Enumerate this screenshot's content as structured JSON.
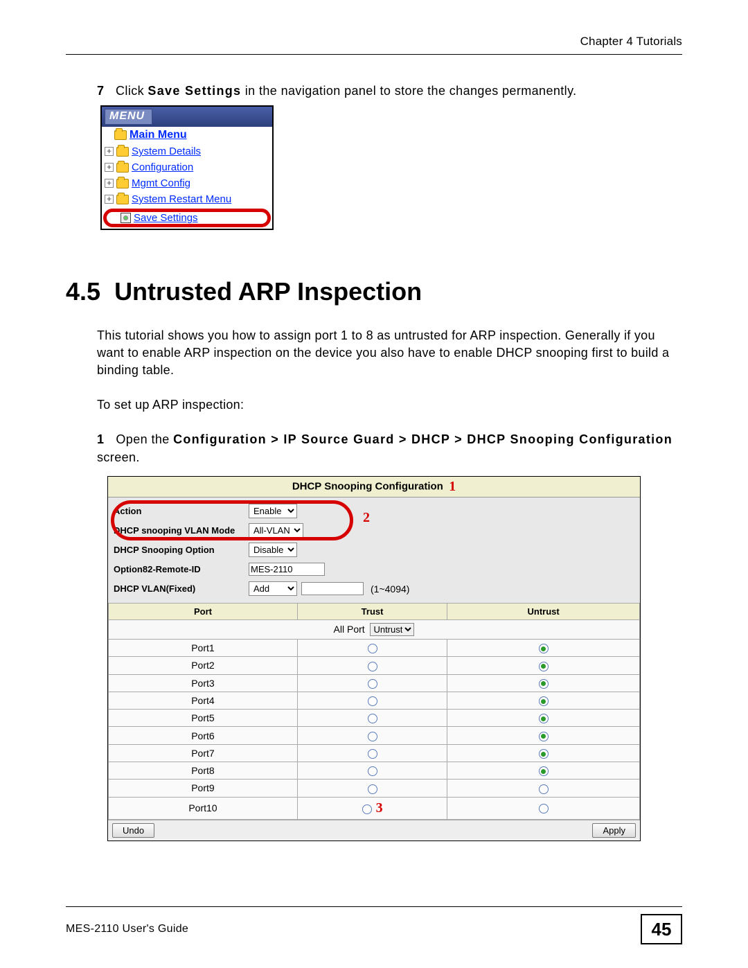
{
  "header": {
    "chapter": "Chapter 4 Tutorials"
  },
  "step7": {
    "num": "7",
    "pre": "Click ",
    "bold": "Save Settings",
    "post": " in the navigation panel to store the changes permanently."
  },
  "menu": {
    "title": "MENU",
    "main": "Main Menu",
    "items": [
      "System Details",
      "Configuration",
      "Mgmt Config",
      "System Restart Menu"
    ],
    "save": "Save Settings"
  },
  "section": {
    "num": "4.5",
    "title": "Untrusted ARP Inspection"
  },
  "intro": "This tutorial shows you how to assign port 1 to 8 as untrusted for ARP inspection. Generally if you want to enable ARP inspection on the device you also have to enable DHCP snooping first to build a binding table.",
  "setup_line": "To set up ARP inspection:",
  "step1": {
    "num": "1",
    "pre": "Open the ",
    "path": "Configuration > IP Source Guard > DHCP > DHCP Snooping Configuration",
    "post": " screen."
  },
  "dhcp": {
    "title": "DHCP Snooping Configuration",
    "anno1": "1",
    "anno2": "2",
    "anno3": "3",
    "rows": {
      "action": {
        "label": "Action",
        "value": "Enable"
      },
      "vlan_mode": {
        "label": "DHCP snooping VLAN Mode",
        "value": "All-VLAN"
      },
      "option": {
        "label": "DHCP Snooping Option",
        "value": "Disable"
      },
      "remote_id": {
        "label": "Option82-Remote-ID",
        "value": "MES-2110"
      },
      "vlan_fixed": {
        "label": "DHCP VLAN(Fixed)",
        "value": "Add",
        "hint": "(1~4094)"
      }
    },
    "headers": {
      "port": "Port",
      "trust": "Trust",
      "untrust": "Untrust"
    },
    "allport": {
      "label": "All Port",
      "value": "Untrust"
    },
    "ports": [
      {
        "name": "Port1",
        "trust": false,
        "untrust": true
      },
      {
        "name": "Port2",
        "trust": false,
        "untrust": true
      },
      {
        "name": "Port3",
        "trust": false,
        "untrust": true
      },
      {
        "name": "Port4",
        "trust": false,
        "untrust": true
      },
      {
        "name": "Port5",
        "trust": false,
        "untrust": true
      },
      {
        "name": "Port6",
        "trust": false,
        "untrust": true
      },
      {
        "name": "Port7",
        "trust": false,
        "untrust": true
      },
      {
        "name": "Port8",
        "trust": false,
        "untrust": true
      },
      {
        "name": "Port9",
        "trust": false,
        "untrust": false
      },
      {
        "name": "Port10",
        "trust": false,
        "untrust": false
      }
    ],
    "buttons": {
      "undo": "Undo",
      "apply": "Apply"
    }
  },
  "footer": {
    "guide": "MES-2110 User's Guide",
    "page": "45"
  }
}
